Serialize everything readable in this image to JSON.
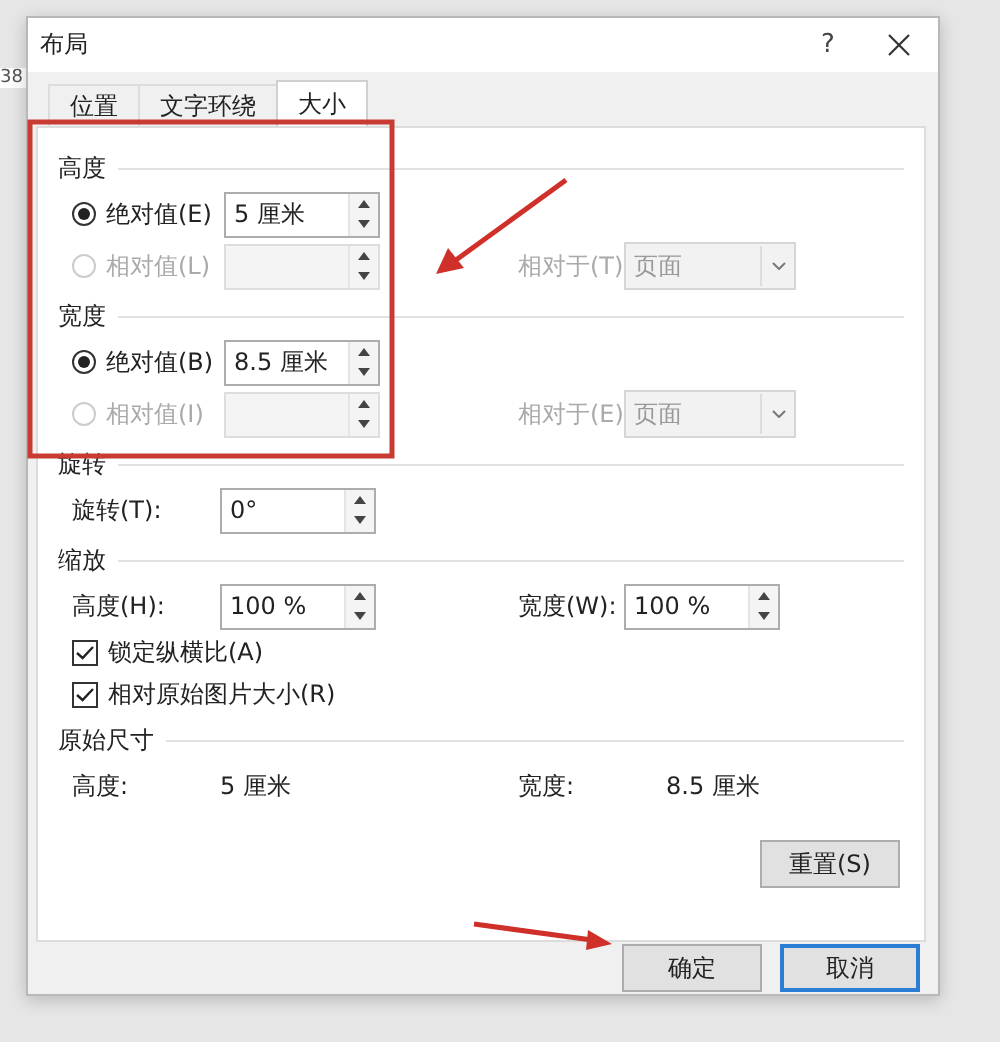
{
  "background_text": "38",
  "window": {
    "title": "布局",
    "help": "?"
  },
  "tabs": [
    {
      "label": "位置",
      "selected": false
    },
    {
      "label": "文字环绕",
      "selected": false
    },
    {
      "label": "大小",
      "selected": true
    }
  ],
  "sections": [
    {
      "title": "高度",
      "rows": [
        {
          "kind": "radio",
          "label": "绝对值(E)",
          "selected": true,
          "disabled": false,
          "value": "5 厘米"
        },
        {
          "kind": "radio",
          "label": "相对值(L)",
          "selected": false,
          "disabled": true,
          "relative": {
            "label": "相对于(T)",
            "value": "页面"
          }
        }
      ]
    },
    {
      "title": "宽度",
      "rows": [
        {
          "kind": "radio",
          "label": "绝对值(B)",
          "selected": true,
          "disabled": false,
          "value": "8.5 厘米"
        },
        {
          "kind": "radio",
          "label": "相对值(I)",
          "selected": false,
          "disabled": true,
          "relative": {
            "label": "相对于(E)",
            "value": "页面"
          }
        }
      ]
    },
    {
      "title": "旋转",
      "rows": [
        {
          "kind": "spin",
          "label": "旋转(T):",
          "value": "0°"
        }
      ]
    },
    {
      "title": "缩放",
      "rows": [
        {
          "kind": "pair",
          "fields": [
            {
              "label": "高度(H):",
              "value": "100 %"
            },
            {
              "label": "宽度(W):",
              "value": "100 %"
            }
          ]
        },
        {
          "kind": "checkbox",
          "label": "锁定纵横比(A)",
          "checked": true
        },
        {
          "kind": "checkbox",
          "label": "相对原始图片大小(R)",
          "checked": true
        }
      ]
    },
    {
      "title": "原始尺寸",
      "rows": [
        {
          "kind": "info",
          "fields": [
            {
              "label": "高度:",
              "value": "5 厘米"
            },
            {
              "label": "宽度:",
              "value": "8.5 厘米"
            }
          ]
        },
        {
          "kind": "reset",
          "label": "重置(S)"
        }
      ]
    }
  ],
  "buttons": [
    {
      "label": "确定",
      "default": false
    },
    {
      "label": "取消",
      "default": true
    }
  ]
}
